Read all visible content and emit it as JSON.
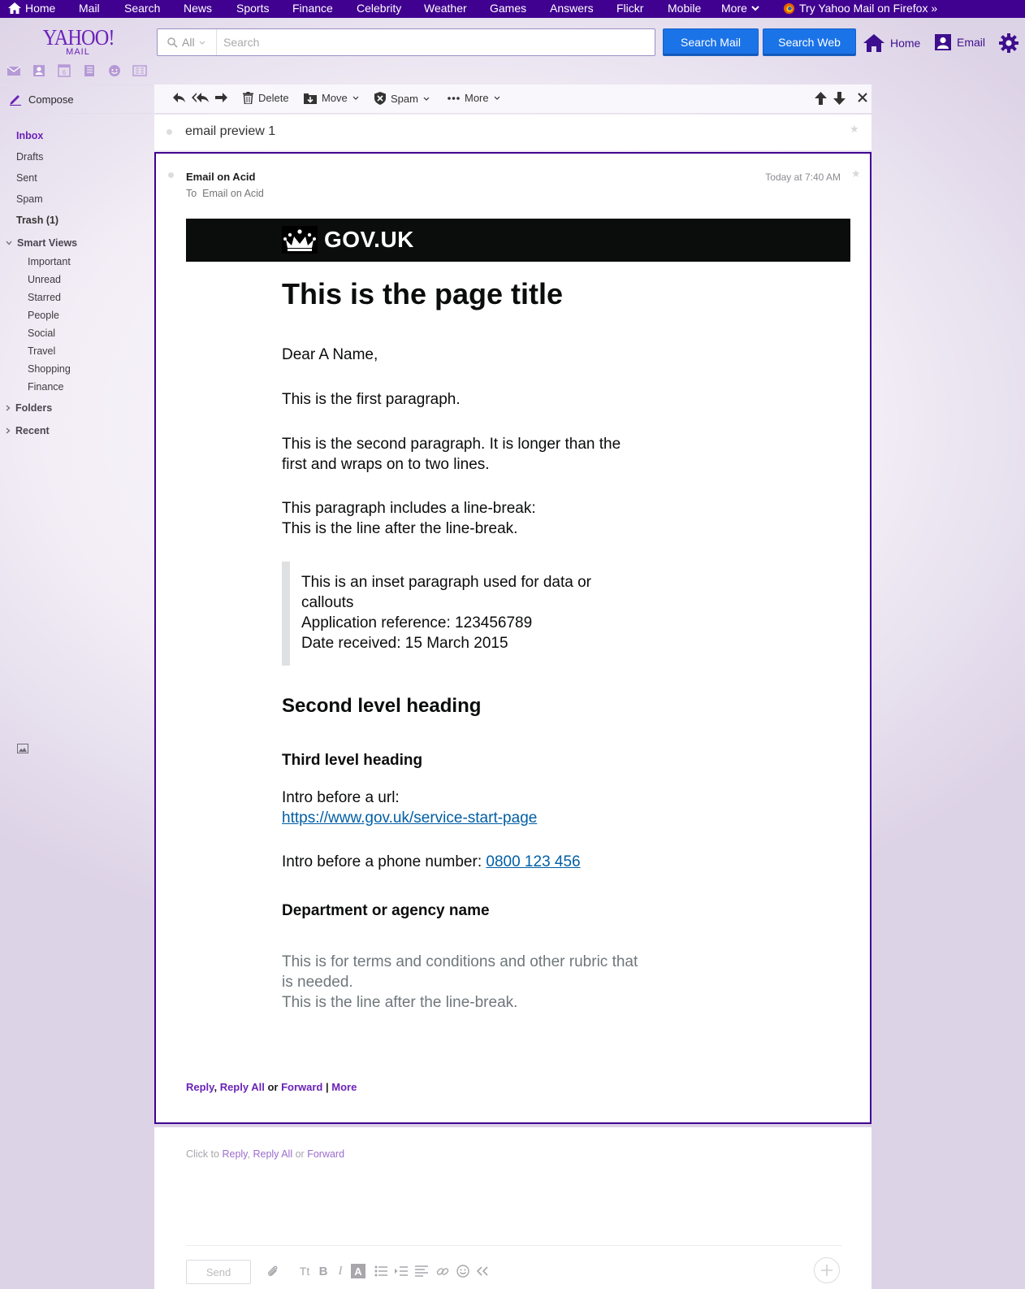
{
  "topnav": {
    "items": [
      "Home",
      "Mail",
      "Search",
      "News",
      "Sports",
      "Finance",
      "Celebrity",
      "Weather",
      "Games",
      "Answers",
      "Flickr",
      "Mobile",
      "More"
    ],
    "promo": "Try Yahoo Mail on Firefox »"
  },
  "header": {
    "logo_brand": "YAHOO!",
    "logo_product": "MAIL",
    "search_scope": "All",
    "search_placeholder": "Search",
    "search_mail_label": "Search Mail",
    "search_web_label": "Search Web",
    "home_label": "Home",
    "email_label": "Email"
  },
  "sidebar": {
    "compose_label": "Compose",
    "folders": [
      "Inbox",
      "Drafts",
      "Sent",
      "Spam",
      "Trash (1)"
    ],
    "smart_views_label": "Smart Views",
    "smart_views": [
      "Important",
      "Unread",
      "Starred",
      "People",
      "Social",
      "Travel",
      "Shopping",
      "Finance"
    ],
    "folders_label": "Folders",
    "recent_label": "Recent"
  },
  "toolbar": {
    "delete_label": "Delete",
    "move_label": "Move",
    "spam_label": "Spam",
    "more_label": "More"
  },
  "conversation": {
    "subject": "email preview 1"
  },
  "message": {
    "sender": "Email on Acid",
    "to_prefix": "To",
    "recipient": "Email on Acid",
    "timestamp": "Today at 7:40 AM",
    "banner_text": "GOV.UK",
    "page_title": "This is the page title",
    "greeting": "Dear A Name,",
    "para1": "This is the first paragraph.",
    "para2": "This is the second paragraph. It is longer than the first and wraps on to two lines.",
    "para3_line1": "This paragraph includes a line-break:",
    "para3_line2": "This is the line after the line-break.",
    "inset_line1": "This is an inset paragraph used for data or callouts",
    "inset_line2": "Application reference: 123456789",
    "inset_line3": "Date received: 15 March 2015",
    "h2": "Second level heading",
    "h3": "Third level heading",
    "url_intro": "Intro before a url:",
    "url": "https://www.gov.uk/service-start-page",
    "phone_intro": "Intro before a phone number:",
    "phone": "0800 123 456",
    "department": "Department or agency name",
    "rubric_line1": "This is for terms and conditions and other rubric that is needed.",
    "rubric_line2": "This is the line after the line-break.",
    "actions": {
      "reply": "Reply",
      "sep1": ",",
      "reply_all": "Reply All",
      "or": "or",
      "forward": "Forward",
      "pipe": "|",
      "more": "More"
    }
  },
  "quick_reply": {
    "click_to": "Click to",
    "reply": "Reply",
    "sep": ",",
    "reply_all": "Reply All",
    "or": "or",
    "forward": "Forward",
    "send_label": "Send",
    "fmt_text_label": "Tt",
    "fmt_bold_label": "B",
    "fmt_italic_label": "I",
    "fmt_color_label": "A"
  },
  "colors": {
    "brand_purple": "#400090",
    "accent_purple": "#6b22b8",
    "button_blue": "#1b73e8",
    "gov_black": "#0b0c0c",
    "gov_link": "#005ea5"
  }
}
